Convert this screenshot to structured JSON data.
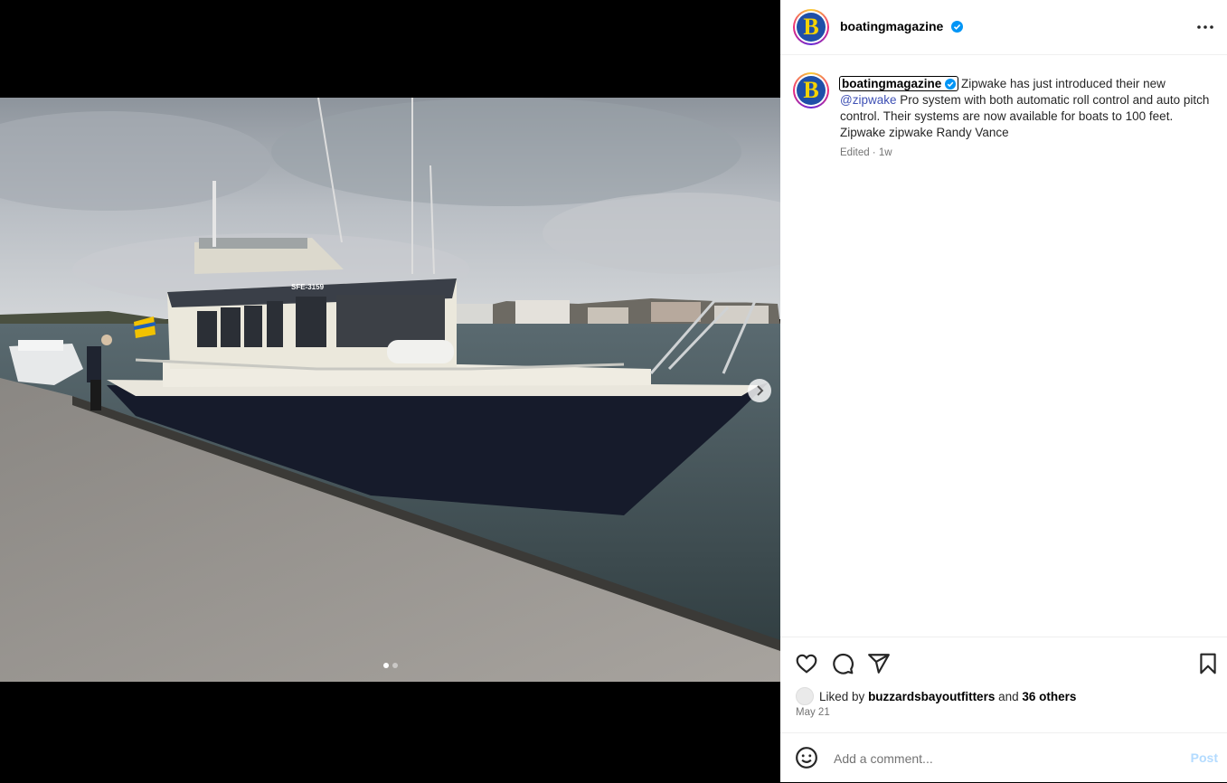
{
  "post": {
    "username": "boatingmagazine",
    "avatar_letter": "B",
    "caption_text_before": " Zipwake has just introduced their new ",
    "mention": "@zipwake",
    "caption_text_after": " Pro system with both automatic roll control and auto pitch control. Their systems are now available for boats to 100 feet. Zipwake zipwake Randy Vance",
    "meta": "Edited · 1w",
    "liked_by_prefix": "Liked by ",
    "liked_by_user": "buzzardsbayoutfitters",
    "liked_by_and": " and ",
    "liked_by_others": "36 others",
    "date": "May 21"
  },
  "photo": {
    "hull_text": "SFE-3159",
    "carousel_dots": 2,
    "active_dot": 0
  },
  "comment": {
    "placeholder": "Add a comment...",
    "post_label": "Post"
  },
  "colors": {
    "accent": "#0095f6",
    "verified": "#0095f6",
    "post_disabled": "#b3dbff",
    "hull": "#1a2033"
  },
  "icons": [
    "more-options-icon",
    "verified-badge-icon",
    "heart-icon",
    "comment-icon",
    "share-icon",
    "bookmark-icon",
    "emoji-icon",
    "chevron-right-icon"
  ]
}
